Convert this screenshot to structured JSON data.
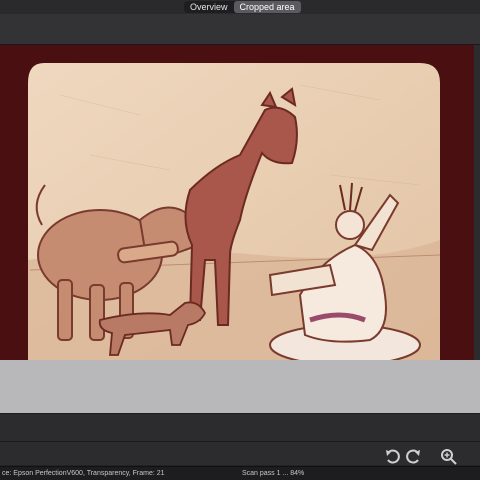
{
  "tabs": [
    {
      "label": "Overview",
      "active": false
    },
    {
      "label": "Cropped area",
      "active": true
    }
  ],
  "colors": {
    "frame_border": "#4a0f10",
    "slide_paper": "#e8cdb0",
    "ink": "#7a3a2e",
    "active_tab": "#5b5b5f"
  },
  "preview": {
    "content": "Scanned illustrated slide: ox and yoked horse, dog, and kneeling figure with raised arms"
  },
  "bottom_icons": [
    "rotate-left-icon",
    "rotate-right-icon",
    "zoom-in-icon"
  ],
  "status": {
    "source": "ce: Epson PerfectionV600, Transparency, Frame: 21",
    "progress": "Scan pass 1 ... 84%"
  }
}
